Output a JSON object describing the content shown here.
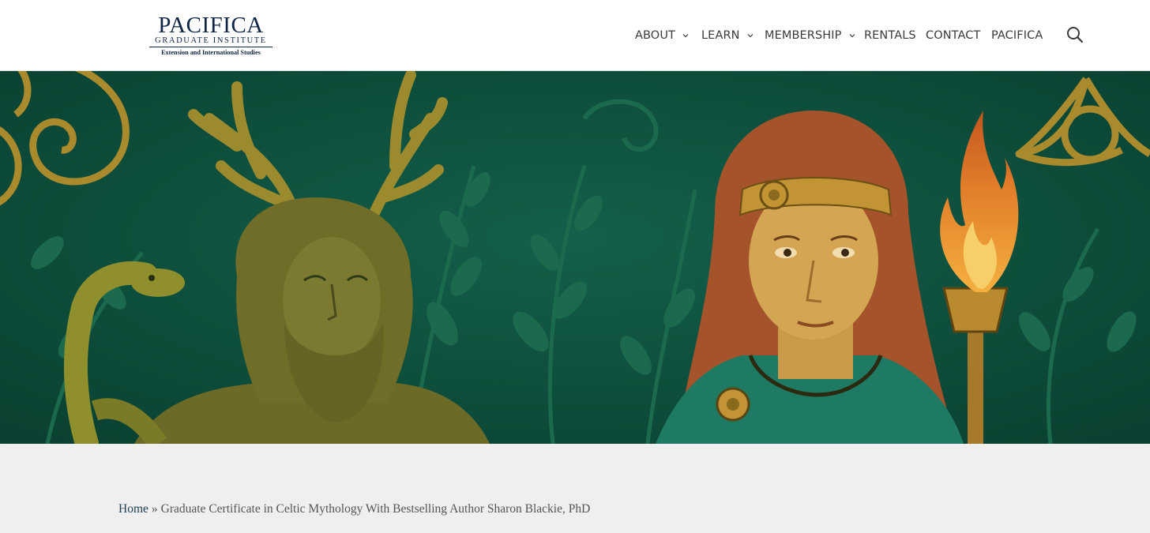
{
  "logo": {
    "name": "PACIFICA",
    "subtitle": "GRADUATE INSTITUTE",
    "tagline": "Extension and International Studies"
  },
  "nav": {
    "items": [
      {
        "label": "ABOUT",
        "has_dropdown": true
      },
      {
        "label": "LEARN",
        "has_dropdown": true
      },
      {
        "label": "MEMBERSHIP",
        "has_dropdown": true
      },
      {
        "label": "RENTALS",
        "has_dropdown": false
      },
      {
        "label": "CONTACT",
        "has_dropdown": false
      },
      {
        "label": "PACIFICA",
        "has_dropdown": false
      }
    ],
    "search_icon": "search-icon"
  },
  "hero": {
    "image_name": "celtic-mythology-hero",
    "colors": {
      "background": "#0d4e3c",
      "gold": "#b8962e",
      "hair": "#a5532a",
      "flame": "#e8842a"
    }
  },
  "breadcrumb": {
    "home": "Home",
    "separator": "»",
    "current": "Graduate Certificate in Celtic Mythology With Bestselling Author Sharon Blackie, PhD"
  }
}
